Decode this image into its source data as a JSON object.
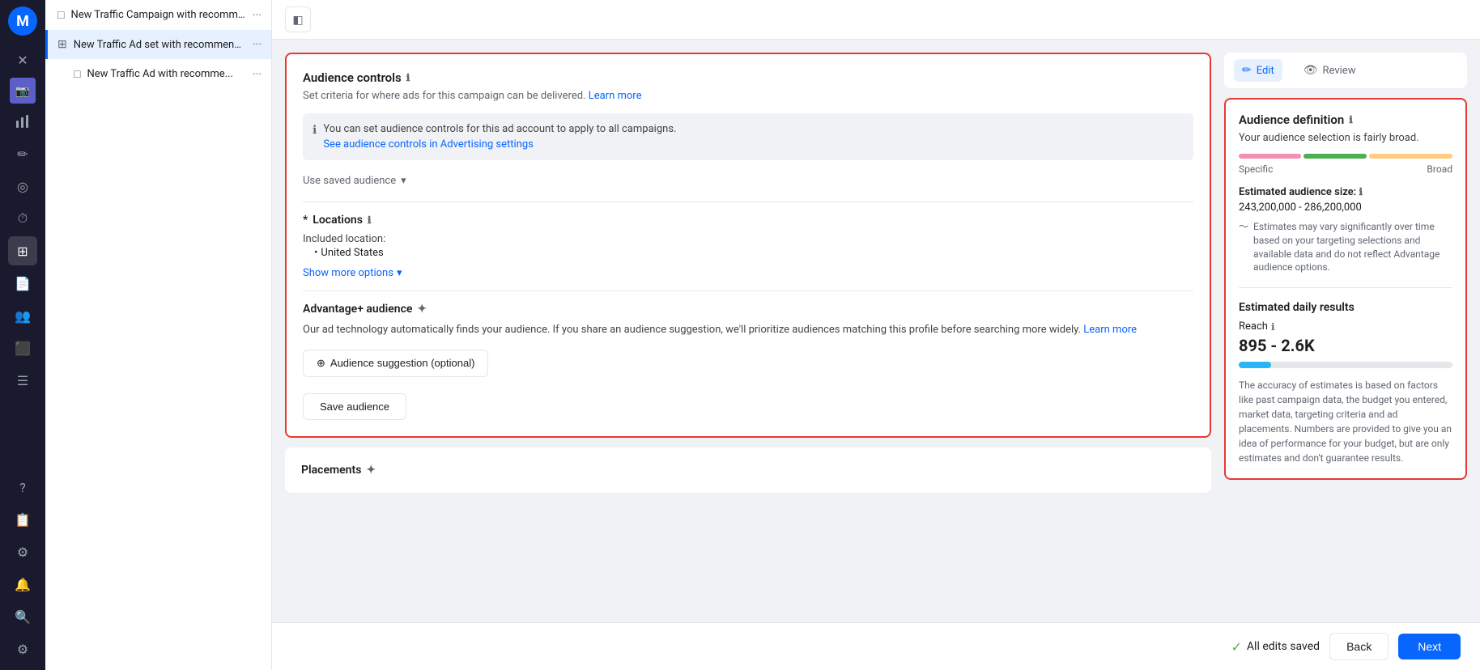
{
  "sidebar": {
    "logo": "M",
    "icons": [
      {
        "name": "close",
        "symbol": "✕",
        "active": false
      },
      {
        "name": "chart",
        "symbol": "📊",
        "active": false
      },
      {
        "name": "pencil",
        "symbol": "✏️",
        "active": false
      },
      {
        "name": "circle",
        "symbol": "◎",
        "active": false
      },
      {
        "name": "clock",
        "symbol": "⏱",
        "active": false
      },
      {
        "name": "grid",
        "symbol": "⊞",
        "active": true
      },
      {
        "name": "document",
        "symbol": "📄",
        "active": false
      },
      {
        "name": "people",
        "symbol": "👥",
        "active": false
      },
      {
        "name": "layers",
        "symbol": "⬛",
        "active": false
      },
      {
        "name": "menu",
        "symbol": "☰",
        "active": false
      },
      {
        "name": "help",
        "symbol": "?",
        "active": false
      },
      {
        "name": "notes",
        "symbol": "📋",
        "active": false
      },
      {
        "name": "settings",
        "symbol": "⚙",
        "active": false
      },
      {
        "name": "bell",
        "symbol": "🔔",
        "active": false
      },
      {
        "name": "search",
        "symbol": "🔍",
        "active": false
      },
      {
        "name": "gear2",
        "symbol": "⚙",
        "active": false
      }
    ]
  },
  "nav": {
    "items": [
      {
        "id": "campaign",
        "label": "New Traffic Campaign with recommend...",
        "icon": "□",
        "active": false,
        "indent": false
      },
      {
        "id": "adset",
        "label": "New Traffic Ad set with recommend...",
        "icon": "⊞",
        "active": true,
        "indent": false
      },
      {
        "id": "ad",
        "label": "New Traffic Ad with recomme...",
        "icon": "□",
        "active": false,
        "indent": true
      }
    ]
  },
  "toolbar": {
    "toggle_icon": "◧"
  },
  "tabs": {
    "edit_label": "Edit",
    "review_label": "Review",
    "edit_icon": "✏",
    "review_icon": "👁"
  },
  "audience_controls": {
    "title": "Audience controls",
    "subtitle": "Set criteria for where ads for this campaign can be delivered.",
    "learn_more": "Learn more",
    "info_box_text": "You can set audience controls for this ad account to apply to all campaigns.",
    "info_box_link": "See audience controls in Advertising settings",
    "use_saved_audience": "Use saved audience",
    "locations": {
      "label": "Locations",
      "included_label": "Included location:",
      "included_value": "United States"
    },
    "show_more": "Show more options",
    "advantage_audience": {
      "title": "Advantage+ audience",
      "description": "Our ad technology automatically finds your audience. If you share an audience suggestion, we'll prioritize audiences matching this profile before searching more widely.",
      "learn_more": "Learn more",
      "suggestion_btn": "Audience suggestion (optional)"
    },
    "save_audience_btn": "Save audience"
  },
  "placements": {
    "title": "Placements"
  },
  "audience_definition": {
    "title": "Audience definition",
    "breadth_desc": "Your audience selection is fairly broad.",
    "specific_label": "Specific",
    "broad_label": "Broad",
    "estimated_size_label": "Estimated audience size:",
    "estimated_size_value": "243,200,000 - 286,200,000",
    "est_note": "Estimates may vary significantly over time based on your targeting selections and available data and do not reflect Advantage audience options.",
    "daily_results": {
      "title": "Estimated daily results",
      "reach_label": "Reach",
      "reach_value": "895 - 2.6K",
      "reach_note": "The accuracy of estimates is based on factors like past campaign data, the budget you entered, market data, targeting criteria and ad placements. Numbers are provided to give you an idea of performance for your budget, but are only estimates and don't guarantee results."
    }
  },
  "bottom_bar": {
    "saved_text": "All edits saved",
    "back_label": "Back",
    "next_label": "Next"
  }
}
